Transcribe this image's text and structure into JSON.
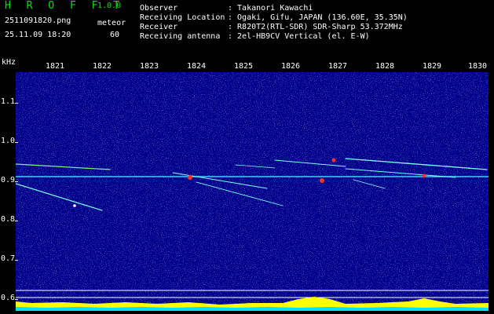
{
  "header": {
    "logo": "H R O F F T",
    "version": "1.0.0",
    "filename": "2511091820.png",
    "meteor_label": "meteor",
    "datetime": "25.11.09 18:20",
    "meteor_count": "60",
    "fields": [
      {
        "label": "Observer",
        "value": ": Takanori Kawachi"
      },
      {
        "label": "Receiving Location",
        "value": ": Ogaki, Gifu, JAPAN (136.60E, 35.35N)"
      },
      {
        "label": "Receiver",
        "value": ": R820T2(RTL-SDR) SDR-Sharp 53.372MHz"
      },
      {
        "label": "Receiving antenna",
        "value": ": 2el-HB9CV Vertical (el. E-W)"
      }
    ]
  },
  "axes": {
    "y_unit": "kHz",
    "x_ticks": [
      "1821",
      "1822",
      "1823",
      "1824",
      "1825",
      "1826",
      "1827",
      "1828",
      "1829",
      "1830"
    ],
    "y_ticks": [
      "1.1",
      "1.0",
      "0.9",
      "0.8",
      "0.7",
      "0.6"
    ]
  },
  "colors": {
    "background": "#00008b",
    "logo": "#00e000",
    "trace_cyan": "#7fffff",
    "trace_green": "#7fff7f",
    "trace_red": "#ff3030",
    "bar_yellow": "#ffff00",
    "bar_cyan": "#00e0ff"
  }
}
